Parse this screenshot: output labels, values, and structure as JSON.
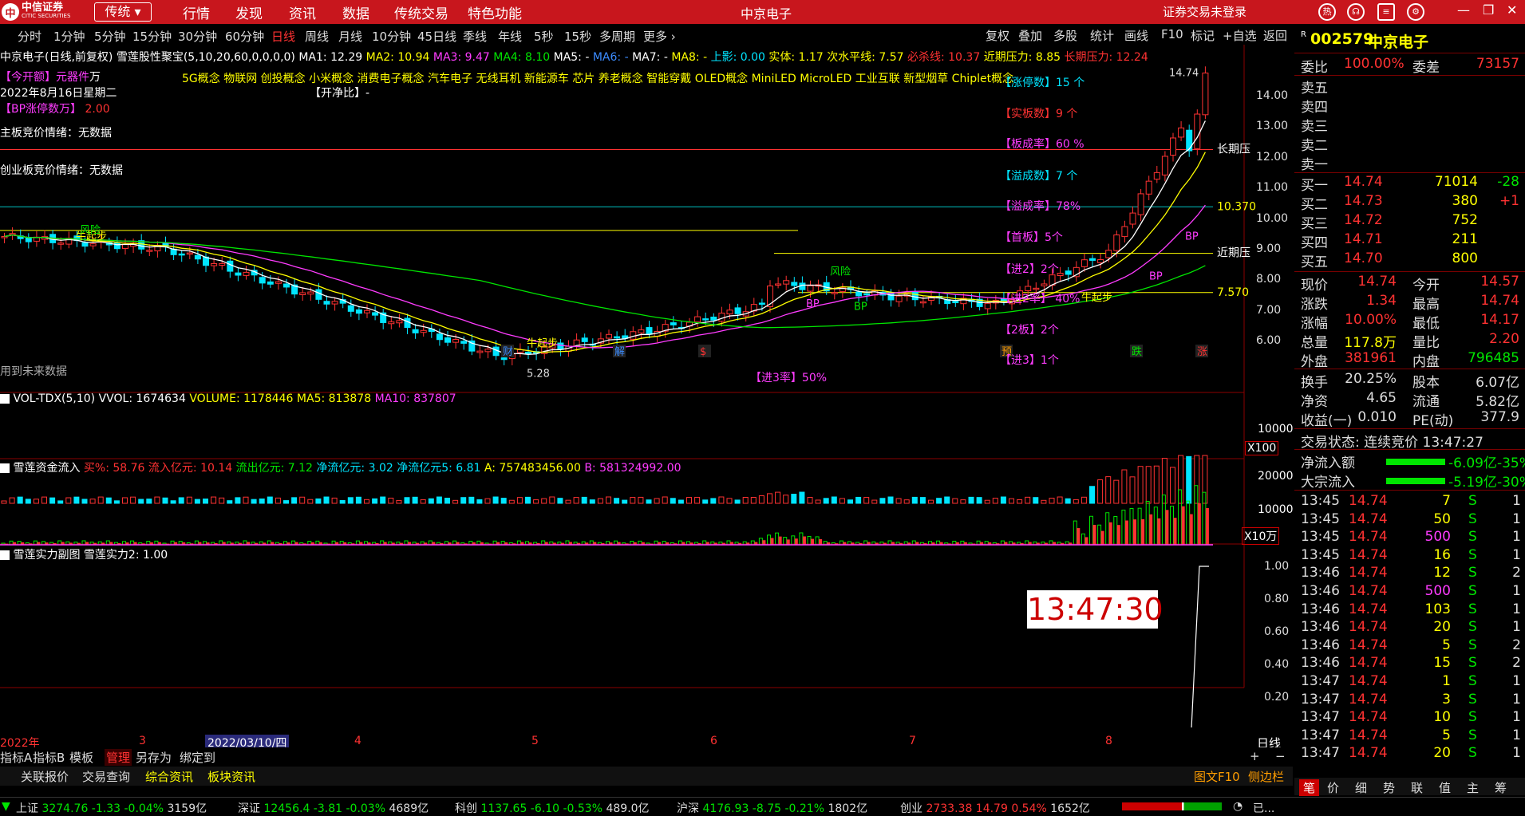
{
  "topbar": {
    "logo_text": "中信证券",
    "logo_sub": "CITIC SECURITIES",
    "mode": "传统",
    "menus": [
      "行情",
      "发现",
      "资讯",
      "数据",
      "传统交易",
      "特色功能"
    ],
    "app_title": "中京电子",
    "login": "证券交易未登录"
  },
  "periods": [
    "分时",
    "1分钟",
    "5分钟",
    "15分钟",
    "30分钟",
    "60分钟",
    "日线",
    "周线",
    "月线",
    "10分钟",
    "45日线",
    "季线",
    "年线",
    "5秒",
    "15秒",
    "多周期",
    "更多"
  ],
  "active_period": "日线",
  "right_tools": [
    "复权",
    "叠加",
    "多股",
    "统计",
    "画线",
    "F10",
    "标记",
    "+自选",
    "返回"
  ],
  "main_chart": {
    "title": "中京电子(日线,前复权)",
    "indicator_name": "雪莲股性聚宝(5,10,20,60,0,0,0,0)",
    "ma1": "MA1: 12.29",
    "ma2": "MA2: 10.94",
    "ma3": "MA3: 9.47",
    "ma4": "MA4: 8.10",
    "ma5": "MA5: -",
    "ma6": "MA6: -",
    "ma7": "MA7: -",
    "ma8": "MA8: -",
    "shadow": "上影: 0.00",
    "body": "实体: 1.17",
    "water": "次水平线: 7.57",
    "stoploss": "必杀线: 10.37",
    "near_pressure": "近期压力: 8.85",
    "long_pressure": "长期压力: 12.24",
    "today_rating": "【今开额】元器件",
    "date_line": "2022年8月16日星期二",
    "zt_count": "2.00",
    "open_ratio": "【开净比】-",
    "main_auction": "主板竞价情绪：无数据",
    "gem_auction": "创业板竞价情绪：无数据",
    "future_data": "用到未来数据",
    "concepts": "5G概念 物联网 创投概念 小米概念 消费电子概念 汽车电子 无线耳机 新能源车 芯片 养老概念 智能穿戴 OLED概念 MiniLED MicroLED 工业互联 新型烟草 Chiplet概念",
    "stats": [
      {
        "label": "【涨停数】15 个",
        "color": "#00e5ff"
      },
      {
        "label": "【实板数】9 个",
        "color": "#ff3232"
      },
      {
        "label": "【板成率】60 %",
        "color": "#ff3cff"
      },
      {
        "label": "【溢成数】7 个",
        "color": "#00e5ff"
      },
      {
        "label": "【溢成率】78%",
        "color": "#ff3cff"
      },
      {
        "label": "【首板】5个",
        "color": "#ff3cff"
      },
      {
        "label": "【进2】2个",
        "color": "#ff3cff"
      },
      {
        "label": "【进2率】 40%",
        "color": "#ff3cff"
      },
      {
        "label": "【2板】2个",
        "color": "#ff3cff"
      },
      {
        "label": "【进3】1个",
        "color": "#ff3cff"
      },
      {
        "label": "【进3率】50%",
        "color": "#ff3cff"
      }
    ],
    "price_axis": [
      "14.00",
      "13.00",
      "12.00",
      "11.00",
      "10.00",
      "9.00",
      "8.00",
      "7.00",
      "6.00"
    ],
    "high_label": "14.74",
    "low_label": "5.28",
    "line_labels": {
      "long": "长期压",
      "near": "近期压",
      "stop": "10.370",
      "water": "7.570"
    },
    "signals": [
      "牛起步",
      "牛起步",
      "牛起步",
      "风险",
      "风险",
      "BP",
      "BP",
      "BP",
      "BP"
    ],
    "event_marks": [
      "财",
      "解",
      "$",
      "预",
      "跌",
      "涨"
    ]
  },
  "vol_panel": {
    "name": "VOL-TDX(5,10)",
    "vvol": "VVOL: 1674634",
    "volume": "VOLUME: 1178446",
    "ma5": "MA5: 813878",
    "ma10": "MA10: 837807",
    "axis": "10000",
    "unit": "X100"
  },
  "flow_panel": {
    "name": "雪莲资金流入",
    "buy": "买%: 58.76",
    "in": "流入亿元: 10.14",
    "out": "流出亿元: 7.12",
    "net": "净流亿元: 3.02",
    "net5": "净流亿元5: 6.81",
    "a": "A: 757483456.00",
    "b": "B: 581324992.00",
    "axis": [
      "20000",
      "10000"
    ],
    "unit": "X10万"
  },
  "power_panel": {
    "name": "雪莲实力副图",
    "value": "雪莲实力2: 1.00",
    "axis": [
      "1.00",
      "0.80",
      "0.60",
      "0.40",
      "0.20"
    ],
    "clock": "13:47:30"
  },
  "x_axis": {
    "labels": [
      "2022年",
      "3",
      "2022/03/10/四",
      "4",
      "5",
      "6",
      "7",
      "8"
    ],
    "period": "日线"
  },
  "bottom_tabs1": [
    "指标A",
    "指标B",
    "模板",
    "管理",
    "另存为",
    "绑定到"
  ],
  "bottom_tabs2": [
    "关联报价",
    "交易查询",
    "综合资讯",
    "板块资讯"
  ],
  "bottom_right": [
    "图文F10",
    "侧边栏"
  ],
  "quote": {
    "code": "002579",
    "name": "中京电子",
    "weibi_label": "委比",
    "weibi": "100.00%",
    "weicha_label": "委差",
    "weicha": "73157",
    "asks": [
      {
        "label": "卖五",
        "price": "",
        "vol": ""
      },
      {
        "label": "卖四",
        "price": "",
        "vol": ""
      },
      {
        "label": "卖三",
        "price": "",
        "vol": ""
      },
      {
        "label": "卖二",
        "price": "",
        "vol": ""
      },
      {
        "label": "卖一",
        "price": "",
        "vol": ""
      }
    ],
    "bids": [
      {
        "label": "买一",
        "price": "14.74",
        "vol": "71014",
        "chg": "-28"
      },
      {
        "label": "买二",
        "price": "14.73",
        "vol": "380",
        "chg": "+1"
      },
      {
        "label": "买三",
        "price": "14.72",
        "vol": "752",
        "chg": ""
      },
      {
        "label": "买四",
        "price": "14.71",
        "vol": "211",
        "chg": ""
      },
      {
        "label": "买五",
        "price": "14.70",
        "vol": "800",
        "chg": ""
      }
    ],
    "info": [
      [
        "现价",
        "14.74",
        "今开",
        "14.57"
      ],
      [
        "涨跌",
        "1.34",
        "最高",
        "14.74"
      ],
      [
        "涨幅",
        "10.00%",
        "最低",
        "14.17"
      ],
      [
        "总量",
        "117.8万",
        "量比",
        "2.20"
      ],
      [
        "外盘",
        "381961",
        "内盘",
        "796485"
      ],
      [
        "换手",
        "20.25%",
        "股本",
        "6.07亿"
      ],
      [
        "净资",
        "4.65",
        "流通",
        "5.82亿"
      ],
      [
        "收益(一)",
        "0.010",
        "PE(动)",
        "377.9"
      ]
    ],
    "trade_status": "交易状态: 连续竞价 13:47:27",
    "net_inflow_label": "净流入额",
    "net_inflow": "-6.09亿-35%",
    "big_inflow_label": "大宗流入",
    "big_inflow": "-5.19亿-30%",
    "ticks": [
      [
        "13:45",
        "14.74",
        "7",
        "S",
        "1"
      ],
      [
        "13:45",
        "14.74",
        "50",
        "S",
        "1"
      ],
      [
        "13:45",
        "14.74",
        "500",
        "S",
        "1"
      ],
      [
        "13:45",
        "14.74",
        "16",
        "S",
        "1"
      ],
      [
        "13:46",
        "14.74",
        "12",
        "S",
        "2"
      ],
      [
        "13:46",
        "14.74",
        "500",
        "S",
        "1"
      ],
      [
        "13:46",
        "14.74",
        "103",
        "S",
        "1"
      ],
      [
        "13:46",
        "14.74",
        "20",
        "S",
        "1"
      ],
      [
        "13:46",
        "14.74",
        "5",
        "S",
        "2"
      ],
      [
        "13:46",
        "14.74",
        "15",
        "S",
        "2"
      ],
      [
        "13:47",
        "14.74",
        "1",
        "S",
        "1"
      ],
      [
        "13:47",
        "14.74",
        "3",
        "S",
        "1"
      ],
      [
        "13:47",
        "14.74",
        "10",
        "S",
        "1"
      ],
      [
        "13:47",
        "14.74",
        "5",
        "S",
        "1"
      ],
      [
        "13:47",
        "14.74",
        "20",
        "S",
        "1"
      ]
    ],
    "bottom_tabs": [
      "笔",
      "价",
      "细",
      "势",
      "联",
      "值",
      "主",
      "筹"
    ]
  },
  "statusbar": {
    "sh": {
      "name": "上证",
      "val": "3274.76",
      "chg": "-1.33",
      "pct": "-0.04%",
      "amt": "3159亿"
    },
    "sz": {
      "name": "深证",
      "val": "12456.4",
      "chg": "-3.81",
      "pct": "-0.03%",
      "amt": "4689亿"
    },
    "kc": {
      "name": "科创",
      "val": "1137.65",
      "chg": "-6.10",
      "pct": "-0.53%",
      "amt": "489.0亿"
    },
    "hs": {
      "name": "沪深",
      "val": "4176.93",
      "chg": "-8.75",
      "pct": "-0.21%",
      "amt": "1802亿"
    },
    "cy": {
      "name": "创业",
      "val": "2733.38",
      "chg": "14.79",
      "pct": "0.54%",
      "amt": "1652亿"
    },
    "extra": "已..."
  }
}
